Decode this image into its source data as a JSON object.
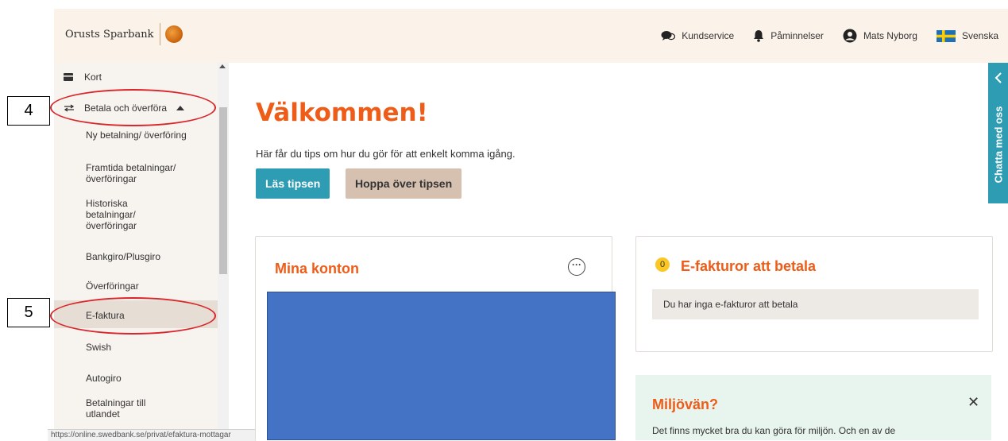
{
  "header": {
    "brand": "Orusts Sparbank",
    "nav": [
      {
        "label": "Kundservice",
        "icon": "chat-bubbles-icon"
      },
      {
        "label": "Påminnelser",
        "icon": "bell-icon"
      },
      {
        "label": "Mats Nyborg",
        "icon": "user-icon"
      },
      {
        "label": "Svenska",
        "icon": "swedish-flag-icon"
      }
    ]
  },
  "sidebar": {
    "top_items": [
      {
        "label": "Kort",
        "icon": "card-icon"
      },
      {
        "label": "Betala och överföra",
        "icon": "transfer-icon"
      }
    ],
    "sub_items": [
      {
        "label": "Ny betalning/ överföring"
      },
      {
        "label": "Framtida betalningar/ överföringar"
      },
      {
        "label": "Historiska betalningar/ överföringar"
      },
      {
        "label": "Bankgiro/Plusgiro"
      },
      {
        "label": "Överföringar"
      },
      {
        "label": "E-faktura"
      },
      {
        "label": "Swish"
      },
      {
        "label": "Autogiro"
      },
      {
        "label": "Betalningar till utlandet"
      }
    ]
  },
  "status_url": "https://online.swedbank.se/privat/efaktura-mottagar",
  "main": {
    "welcome_title": "Välkommen!",
    "intro_text": "Här får du tips om hur du gör för att enkelt komma igång.",
    "read_tips_button": "Läs tipsen",
    "skip_tips_button": "Hoppa över tipsen",
    "accounts_card_title": "Mina konton",
    "efaktura_card": {
      "count": "0",
      "title": "E-fakturor att betala",
      "info": "Du har inga e-fakturor att betala"
    },
    "eco_card": {
      "title": "Miljövän?",
      "close": "✕",
      "text": "Det finns mycket bra du kan göra för miljön. Och en av de"
    }
  },
  "chat_tab": "Chatta med oss",
  "annotations": [
    {
      "number": "4"
    },
    {
      "number": "5"
    }
  ],
  "colors": {
    "accent_orange": "#ee5c17",
    "teal": "#2e9db4",
    "header_bg": "#fbf2ea",
    "annotation_red": "#d9262b"
  }
}
